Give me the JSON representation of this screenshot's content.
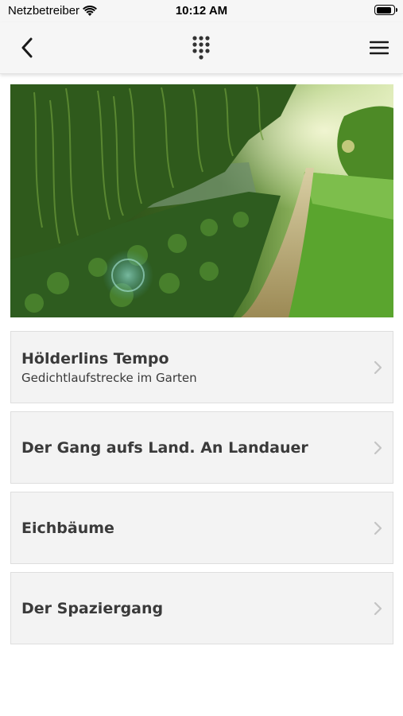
{
  "status_bar": {
    "carrier": "Netzbetreiber",
    "time": "10:12 AM",
    "battery_level": 0.9
  },
  "nav": {
    "back_icon": "chevron-left-icon",
    "center_icon": "dialpad-grid-icon",
    "menu_icon": "hamburger-menu-icon"
  },
  "hero": {
    "image": "garden-path-with-weeping-willow"
  },
  "items": [
    {
      "title": "Hölderlins Tempo",
      "subtitle": "Gedichtlaufstrecke im Garten"
    },
    {
      "title": "Der Gang aufs Land. An Landauer",
      "subtitle": ""
    },
    {
      "title": "Eichbäume",
      "subtitle": ""
    },
    {
      "title": "Der Spaziergang",
      "subtitle": ""
    }
  ],
  "colors": {
    "bar_background": "#f6f6f6",
    "card_background": "#f3f3f3",
    "text": "#3a3a3a",
    "chevron": "#c4c4c4"
  }
}
